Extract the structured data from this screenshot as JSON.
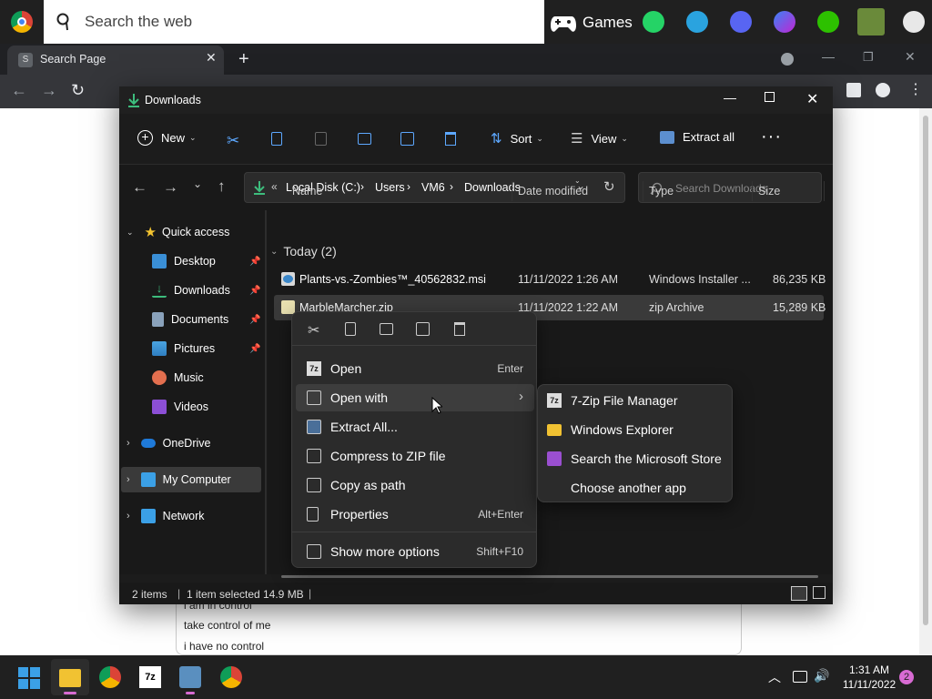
{
  "topbar": {
    "search_placeholder": "Search the web",
    "games_label": "Games",
    "icons": [
      "chrome-icon",
      "search-icon",
      "gamepad-icon",
      "whatsapp-icon",
      "telegram-icon",
      "discord-icon",
      "messenger-icon",
      "wechat-icon",
      "game-avatar-icon",
      "settings-icon"
    ]
  },
  "browser": {
    "tab_title": "Search Page",
    "tab_favicon": "S"
  },
  "webpage": {
    "chat_lines": [
      "i am in control",
      "take control of me",
      "i have no control"
    ]
  },
  "explorer": {
    "title": "Downloads",
    "cmd": {
      "new_label": "New",
      "sort_label": "Sort",
      "view_label": "View",
      "extract_label": "Extract all"
    },
    "breadcrumb": {
      "prefix": "«",
      "parts": [
        "Local Disk (C:)",
        "Users",
        "VM6",
        "Downloads"
      ]
    },
    "search_placeholder": "Search Downloads",
    "nav": {
      "quick_access": "Quick access",
      "items": [
        "Desktop",
        "Downloads",
        "Documents",
        "Pictures",
        "Music",
        "Videos"
      ],
      "onedrive": "OneDrive",
      "mycomputer": "My Computer",
      "network": "Network"
    },
    "columns": {
      "name": "Name",
      "date": "Date modified",
      "type": "Type",
      "size": "Size"
    },
    "group_header": "Today (2)",
    "files": [
      {
        "name": "Plants-vs.-Zombies™_40562832.msi",
        "date": "11/11/2022 1:26 AM",
        "type": "Windows Installer ...",
        "size": "86,235 KB"
      },
      {
        "name": "MarbleMarcher.zip",
        "date": "11/11/2022 1:22 AM",
        "type": "zip Archive",
        "size": "15,289 KB"
      }
    ],
    "status": {
      "items": "2 items",
      "selected": "1 item selected",
      "size": "14.9 MB",
      "sep": "|"
    }
  },
  "context_menu": {
    "items": [
      {
        "label": "Open",
        "shortcut": "Enter"
      },
      {
        "label": "Open with",
        "shortcut": "›"
      },
      {
        "label": "Extract All...",
        "shortcut": ""
      },
      {
        "label": "Compress to ZIP file",
        "shortcut": ""
      },
      {
        "label": "Copy as path",
        "shortcut": ""
      },
      {
        "label": "Properties",
        "shortcut": "Alt+Enter"
      },
      {
        "label": "Show more options",
        "shortcut": "Shift+F10"
      }
    ]
  },
  "submenu": {
    "items": [
      "7-Zip File Manager",
      "Windows Explorer",
      "Search the Microsoft Store",
      "Choose another app"
    ]
  },
  "taskbar": {
    "time": "1:31 AM",
    "date": "11/11/2022",
    "notification_count": "2"
  },
  "colors": {
    "accent": "#3d8ee0",
    "explorer_bg": "#1c1c1c",
    "menu_bg": "#2b2b2b",
    "selection": "#404040"
  }
}
